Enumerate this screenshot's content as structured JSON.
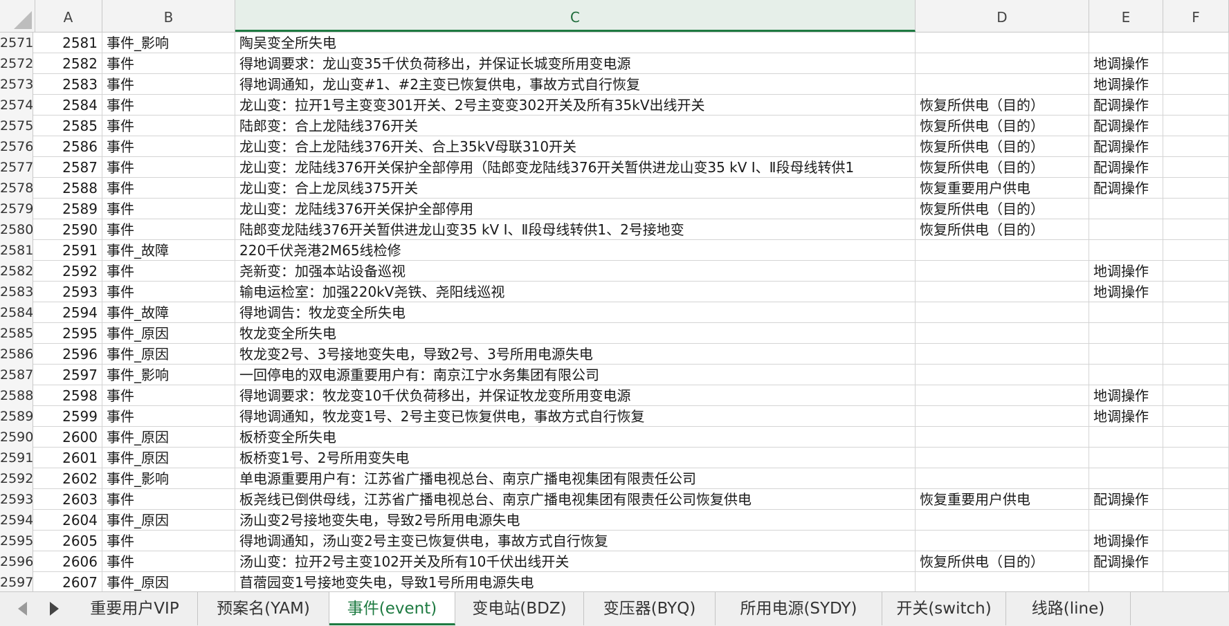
{
  "columns": [
    "A",
    "B",
    "C",
    "D",
    "E",
    "F"
  ],
  "selected_column": "C",
  "rows": [
    {
      "rn": "2571",
      "a": "2581",
      "b": "事件_影响",
      "c": "陶吴变全所失电",
      "d": "",
      "e": ""
    },
    {
      "rn": "2572",
      "a": "2582",
      "b": "事件",
      "c": "得地调要求：龙山变35千伏负荷移出，并保证长城变所用变电源",
      "d": "",
      "e": "地调操作"
    },
    {
      "rn": "2573",
      "a": "2583",
      "b": "事件",
      "c": "得地调通知，龙山变#1、#2主变已恢复供电，事故方式自行恢复",
      "d": "",
      "e": "地调操作"
    },
    {
      "rn": "2574",
      "a": "2584",
      "b": "事件",
      "c": "龙山变：拉开1号主变变301开关、2号主变变302开关及所有35kV出线开关",
      "d": "恢复所供电（目的）",
      "e": "配调操作"
    },
    {
      "rn": "2575",
      "a": "2585",
      "b": "事件",
      "c": "陆郎变：合上龙陆线376开关",
      "d": "恢复所供电（目的）",
      "e": "配调操作"
    },
    {
      "rn": "2576",
      "a": "2586",
      "b": "事件",
      "c": "龙山变：合上龙陆线376开关、合上35kV母联310开关",
      "d": "恢复所供电（目的）",
      "e": "配调操作"
    },
    {
      "rn": "2577",
      "a": "2587",
      "b": "事件",
      "c": "龙山变：龙陆线376开关保护全部停用（陆郎变龙陆线376开关暂供进龙山变35 kV Ⅰ、Ⅱ段母线转供1",
      "d": "恢复所供电（目的）",
      "e": "配调操作"
    },
    {
      "rn": "2578",
      "a": "2588",
      "b": "事件",
      "c": "龙山变：合上龙凤线375开关",
      "d": "恢复重要用户供电",
      "e": "配调操作"
    },
    {
      "rn": "2579",
      "a": "2589",
      "b": "事件",
      "c": "龙山变：龙陆线376开关保护全部停用",
      "d": "恢复所供电（目的）",
      "e": ""
    },
    {
      "rn": "2580",
      "a": "2590",
      "b": "事件",
      "c": "陆郎变龙陆线376开关暂供进龙山变35 kV Ⅰ、Ⅱ段母线转供1、2号接地变",
      "d": "恢复所供电（目的）",
      "e": ""
    },
    {
      "rn": "2581",
      "a": "2591",
      "b": "事件_故障",
      "c": "220千伏尧港2M65线检修",
      "d": "",
      "e": ""
    },
    {
      "rn": "2582",
      "a": "2592",
      "b": "事件",
      "c": "尧新变：加强本站设备巡视",
      "d": "",
      "e": "地调操作"
    },
    {
      "rn": "2583",
      "a": "2593",
      "b": "事件",
      "c": "输电运检室：加强220kV尧铁、尧阳线巡视",
      "d": "",
      "e": "地调操作"
    },
    {
      "rn": "2584",
      "a": "2594",
      "b": "事件_故障",
      "c": "得地调告：牧龙变全所失电",
      "d": "",
      "e": ""
    },
    {
      "rn": "2585",
      "a": "2595",
      "b": "事件_原因",
      "c": "牧龙变全所失电",
      "d": "",
      "e": ""
    },
    {
      "rn": "2586",
      "a": "2596",
      "b": "事件_原因",
      "c": "牧龙变2号、3号接地变失电，导致2号、3号所用电源失电",
      "d": "",
      "e": ""
    },
    {
      "rn": "2587",
      "a": "2597",
      "b": "事件_影响",
      "c": "一回停电的双电源重要用户有：南京江宁水务集团有限公司",
      "d": "",
      "e": ""
    },
    {
      "rn": "2588",
      "a": "2598",
      "b": "事件",
      "c": "得地调要求：牧龙变10千伏负荷移出，并保证牧龙变所用变电源",
      "d": "",
      "e": "地调操作"
    },
    {
      "rn": "2589",
      "a": "2599",
      "b": "事件",
      "c": "得地调通知，牧龙变1号、2号主变已恢复供电，事故方式自行恢复",
      "d": "",
      "e": "地调操作"
    },
    {
      "rn": "2590",
      "a": "2600",
      "b": "事件_原因",
      "c": "板桥变全所失电",
      "d": "",
      "e": ""
    },
    {
      "rn": "2591",
      "a": "2601",
      "b": "事件_原因",
      "c": "板桥变1号、2号所用变失电",
      "d": "",
      "e": ""
    },
    {
      "rn": "2592",
      "a": "2602",
      "b": "事件_影响",
      "c": "单电源重要用户有：江苏省广播电视总台、南京广播电视集团有限责任公司",
      "d": "",
      "e": ""
    },
    {
      "rn": "2593",
      "a": "2603",
      "b": "事件",
      "c": "板尧线已倒供母线，江苏省广播电视总台、南京广播电视集团有限责任公司恢复供电",
      "d": "恢复重要用户供电",
      "e": "配调操作"
    },
    {
      "rn": "2594",
      "a": "2604",
      "b": "事件_原因",
      "c": "汤山变2号接地变失电，导致2号所用电源失电",
      "d": "",
      "e": ""
    },
    {
      "rn": "2595",
      "a": "2605",
      "b": "事件",
      "c": "得地调通知，汤山变2号主变已恢复供电，事故方式自行恢复",
      "d": "",
      "e": "地调操作"
    },
    {
      "rn": "2596",
      "a": "2606",
      "b": "事件",
      "c": "汤山变：拉开2号主变102开关及所有10千伏出线开关",
      "d": "恢复所供电（目的）",
      "e": "配调操作"
    },
    {
      "rn": "2597",
      "a": "2607",
      "b": "事件_原因",
      "c": "苜蓿园变1号接地变失电，导致1号所用电源失电",
      "d": "",
      "e": ""
    }
  ],
  "tabs": [
    {
      "label": "重要用户VIP",
      "active": false
    },
    {
      "label": "预案名(YAM)",
      "active": false
    },
    {
      "label": "事件(event)",
      "active": true
    },
    {
      "label": "变电站(BDZ)",
      "active": false
    },
    {
      "label": "变压器(BYQ)",
      "active": false
    },
    {
      "label": "所用电源(SYDY)",
      "active": false
    },
    {
      "label": "开关(switch)",
      "active": false
    },
    {
      "label": "线路(line)",
      "active": false
    }
  ],
  "colors": {
    "accent": "#1e7a41"
  }
}
